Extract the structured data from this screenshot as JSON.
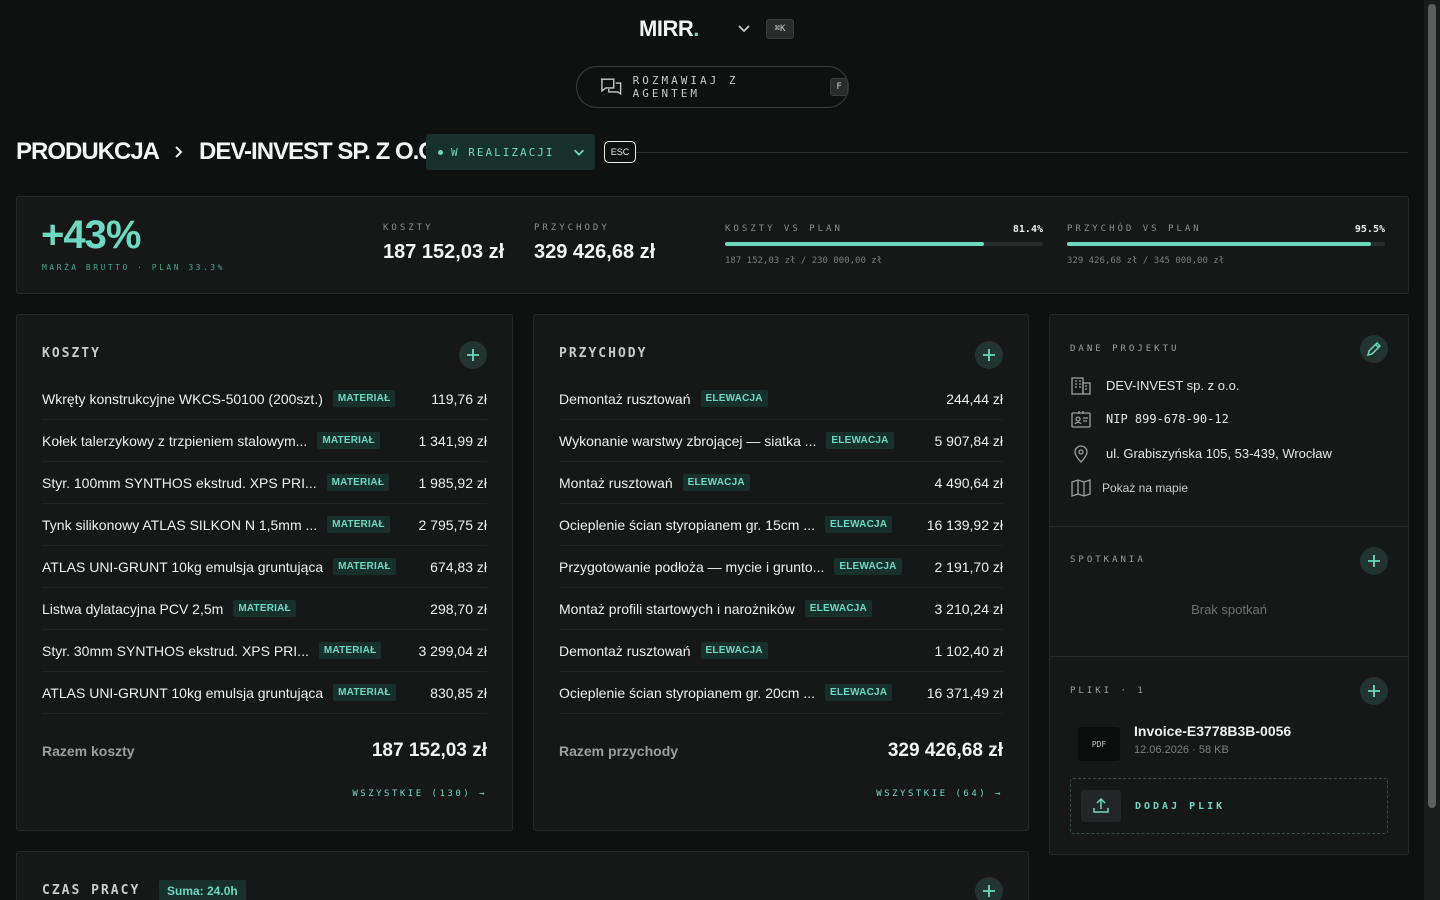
{
  "header": {
    "logo_text": "MIRR",
    "logo_dot": ".",
    "shortcut": "⌘K",
    "agent_label": "ROZMAWIAJ Z AGENTEM",
    "agent_key": "F"
  },
  "breadcrumb": {
    "section": "PRODUKCJA",
    "project": "DEV-INVEST SP. Z O.O.",
    "status": "W REALIZACJI",
    "esc": "ESC"
  },
  "summary": {
    "margin": "+43%",
    "margin_label": "MARŻA BRUTTO · PLAN 33.3%",
    "costs_label": "KOSZTY",
    "costs_value": "187 152,03 zł",
    "revenue_label": "PRZYCHODY",
    "revenue_value": "329 426,68 zł",
    "cost_plan": {
      "label": "KOSZTY VS PLAN",
      "pct": "81.4%",
      "detail": "187 152,03 zł / 230 000,00 zł",
      "fraction": 0.814
    },
    "revenue_plan": {
      "label": "PRZYCHÓD VS PLAN",
      "pct": "95.5%",
      "detail": "329 426,68 zł / 345 000,00 zł",
      "fraction": 0.955
    }
  },
  "costs": {
    "title": "KOSZTY",
    "items": [
      {
        "name": "Wkręty konstrukcyjne WKCS-50100 (200szt.)",
        "tag": "MATERIAŁ",
        "amount": "119,76 zł"
      },
      {
        "name": "Kołek talerzykowy z trzpieniem stalowym...",
        "tag": "MATERIAŁ",
        "amount": "1 341,99 zł"
      },
      {
        "name": "Styr. 100mm SYNTHOS ekstrud. XPS PRI...",
        "tag": "MATERIAŁ",
        "amount": "1 985,92 zł"
      },
      {
        "name": "Tynk silikonowy ATLAS SILKON N 1,5mm ...",
        "tag": "MATERIAŁ",
        "amount": "2 795,75 zł"
      },
      {
        "name": "ATLAS UNI-GRUNT 10kg emulsja gruntująca",
        "tag": "MATERIAŁ",
        "amount": "674,83 zł"
      },
      {
        "name": "Listwa dylatacyjna PCV 2,5m",
        "tag": "MATERIAŁ",
        "amount": "298,70 zł"
      },
      {
        "name": "Styr. 30mm SYNTHOS ekstrud. XPS PRI...",
        "tag": "MATERIAŁ",
        "amount": "3 299,04 zł"
      },
      {
        "name": "ATLAS UNI-GRUNT 10kg emulsja gruntująca",
        "tag": "MATERIAŁ",
        "amount": "830,85 zł"
      }
    ],
    "total_label": "Razem koszty",
    "total_value": "187 152,03 zł",
    "see_all": "WSZYSTKIE (130) →"
  },
  "revenue": {
    "title": "PRZYCHODY",
    "items": [
      {
        "name": "Demontaż rusztowań",
        "tag": "ELEWACJA",
        "amount": "244,44 zł"
      },
      {
        "name": "Wykonanie warstwy zbrojącej — siatka ...",
        "tag": "ELEWACJA",
        "amount": "5 907,84 zł"
      },
      {
        "name": "Montaż rusztowań",
        "tag": "ELEWACJA",
        "amount": "4 490,64 zł"
      },
      {
        "name": "Ocieplenie ścian styropianem gr. 15cm ...",
        "tag": "ELEWACJA",
        "amount": "16 139,92 zł"
      },
      {
        "name": "Przygotowanie podłoża — mycie i grunto...",
        "tag": "ELEWACJA",
        "amount": "2 191,70 zł"
      },
      {
        "name": "Montaż profili startowych i narożników",
        "tag": "ELEWACJA",
        "amount": "3 210,24 zł"
      },
      {
        "name": "Demontaż rusztowań",
        "tag": "ELEWACJA",
        "amount": "1 102,40 zł"
      },
      {
        "name": "Ocieplenie ścian styropianem gr. 20cm ...",
        "tag": "ELEWACJA",
        "amount": "16 371,49 zł"
      }
    ],
    "total_label": "Razem przychody",
    "total_value": "329 426,68 zł",
    "see_all": "WSZYSTKIE (64) →"
  },
  "project": {
    "title": "DANE PROJEKTU",
    "company": "DEV-INVEST sp. z o.o.",
    "nip": "NIP 899-678-90-12",
    "address": "ul. Grabiszyńska 105, 53-439, Wrocław",
    "map_link": "Pokaż na mapie"
  },
  "meetings": {
    "title": "SPOTKANIA",
    "empty": "Brak spotkań"
  },
  "files": {
    "title": "PLIKI · 1",
    "items": [
      {
        "type": "PDF",
        "name": "Invoice-E3778B3B-0056",
        "meta": "12.06.2026 · 58 KB"
      }
    ],
    "add_label": "DODAJ PLIK"
  },
  "worktime": {
    "title": "CZAS PRACY",
    "sum": "Suma: 24.0h"
  },
  "colors": {
    "accent": "#6fd8c2",
    "background": "#0f1010",
    "panel": "#161818"
  }
}
